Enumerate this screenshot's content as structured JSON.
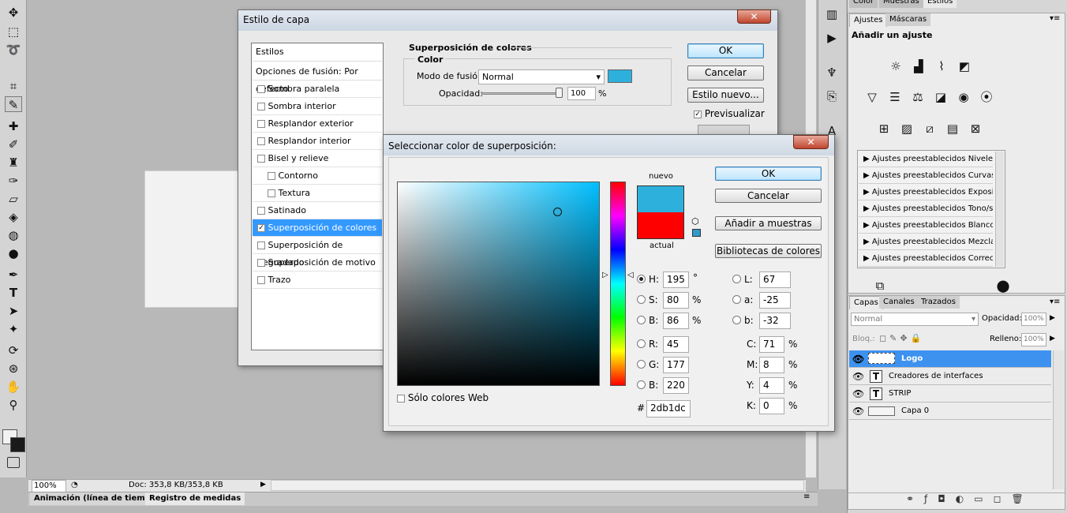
{
  "status_bar": {
    "zoom": "100%",
    "doc": "Doc: 353,8 KB/353,8 KB"
  },
  "bottom_tabs": [
    "Animación (línea de tiempo)",
    "Registro de medidas"
  ],
  "layer_style_dialog": {
    "title": "Estilo de capa",
    "styles_header": "Estilos",
    "blend_options": "Opciones de fusión: Por defecto",
    "items": [
      {
        "label": "Sombra paralela",
        "checked": false,
        "indent": false,
        "selected": false
      },
      {
        "label": "Sombra interior",
        "checked": false,
        "indent": false,
        "selected": false
      },
      {
        "label": "Resplandor exterior",
        "checked": false,
        "indent": false,
        "selected": false
      },
      {
        "label": "Resplandor interior",
        "checked": false,
        "indent": false,
        "selected": false
      },
      {
        "label": "Bisel y relieve",
        "checked": false,
        "indent": false,
        "selected": false
      },
      {
        "label": "Contorno",
        "checked": false,
        "indent": true,
        "selected": false
      },
      {
        "label": "Textura",
        "checked": false,
        "indent": true,
        "selected": false
      },
      {
        "label": "Satinado",
        "checked": false,
        "indent": false,
        "selected": false
      },
      {
        "label": "Superposición de colores",
        "checked": true,
        "indent": false,
        "selected": true
      },
      {
        "label": "Superposición de degradado",
        "checked": false,
        "indent": false,
        "selected": false
      },
      {
        "label": "Superposición de motivo",
        "checked": false,
        "indent": false,
        "selected": false
      },
      {
        "label": "Trazo",
        "checked": false,
        "indent": false,
        "selected": false
      }
    ],
    "section_title": "Superposición de colores",
    "group_title": "Color",
    "blend_mode_label": "Modo de fusión:",
    "blend_mode_value": "Normal",
    "opacity_label": "Opacidad:",
    "opacity_value": "100",
    "opacity_unit": "%",
    "overlay_color": "#2db1dc",
    "ok": "OK",
    "cancel": "Cancelar",
    "new_style": "Estilo nuevo...",
    "preview": "Previsualizar"
  },
  "color_picker": {
    "title": "Seleccionar color de superposición:",
    "new_label": "nuevo",
    "current_label": "actual",
    "new_color": "#2db1dc",
    "current_color": "#ff0000",
    "ok": "OK",
    "cancel": "Cancelar",
    "add_swatch": "Añadir a muestras",
    "libraries": "Bibliotecas de colores",
    "web_only": "Sólo colores Web",
    "hue_base": "#00bfff",
    "fields_left": [
      {
        "label": "H:",
        "value": "195",
        "unit": "°",
        "selected": true
      },
      {
        "label": "S:",
        "value": "80",
        "unit": "%",
        "selected": false
      },
      {
        "label": "B:",
        "value": "86",
        "unit": "%",
        "selected": false
      },
      {
        "label": "R:",
        "value": "45",
        "unit": "",
        "selected": false
      },
      {
        "label": "G:",
        "value": "177",
        "unit": "",
        "selected": false
      },
      {
        "label": "B:",
        "value": "220",
        "unit": "",
        "selected": false
      }
    ],
    "fields_lab": [
      {
        "label": "L:",
        "value": "67"
      },
      {
        "label": "a:",
        "value": "-25"
      },
      {
        "label": "b:",
        "value": "-32"
      }
    ],
    "fields_cmyk": [
      {
        "label": "C:",
        "value": "71",
        "unit": "%"
      },
      {
        "label": "M:",
        "value": "8",
        "unit": "%"
      },
      {
        "label": "Y:",
        "value": "4",
        "unit": "%"
      },
      {
        "label": "K:",
        "value": "0",
        "unit": "%"
      }
    ],
    "hex_label": "#",
    "hex_value": "2db1dc"
  },
  "panels": {
    "top_tabs": [
      "Color",
      "Muestras",
      "Estilos"
    ],
    "adj_tabs": [
      "Ajustes",
      "Máscaras"
    ],
    "adj_title": "Añadir un ajuste",
    "presets": [
      "Ajustes preestablecidos Niveles",
      "Ajustes preestablecidos Curvas",
      "Ajustes preestablecidos Exposición",
      "Ajustes preestablecidos Tono/saturación",
      "Ajustes preestablecidos Blanco y negro",
      "Ajustes preestablecidos Mezclador de canales",
      "Ajustes preestablecidos Corrección selectiva"
    ],
    "layer_tabs": [
      "Capas",
      "Canales",
      "Trazados"
    ],
    "blend": "Normal",
    "opacity_label": "Opacidad:",
    "opacity": "100%",
    "lock_label": "Bloq.:",
    "fill_label": "Relleno:",
    "fill": "100%",
    "layers": [
      {
        "name": "Logo",
        "type": "pixel",
        "selected": true
      },
      {
        "name": "Creadores de interfaces",
        "type": "text",
        "selected": false
      },
      {
        "name": "STRIP",
        "type": "text",
        "selected": false
      },
      {
        "name": "Capa 0",
        "type": "pixel",
        "selected": false
      }
    ]
  }
}
